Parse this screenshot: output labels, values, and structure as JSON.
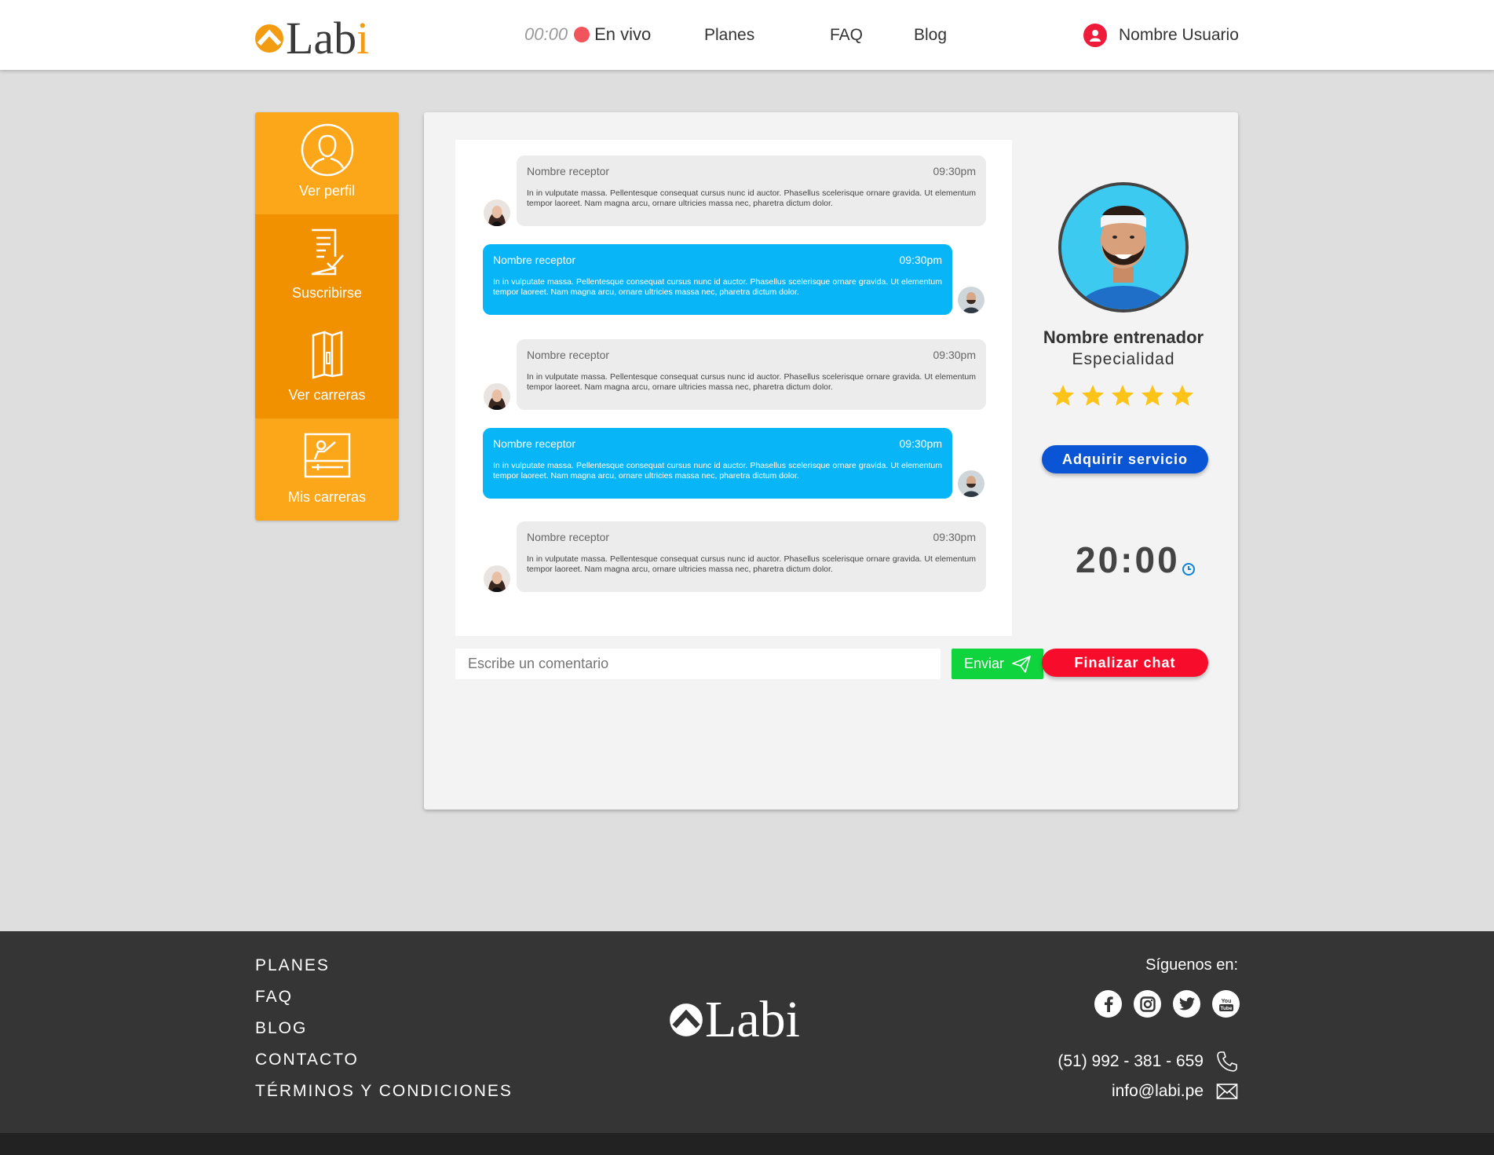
{
  "header": {
    "logo": {
      "text_main": "Lab",
      "text_accent": "i"
    },
    "live": {
      "time": "00:00",
      "label": "En vivo"
    },
    "nav": [
      "Planes",
      "FAQ",
      "Blog"
    ],
    "user_name": "Nombre Usuario"
  },
  "sidebar": {
    "items": [
      {
        "label": "Ver perfil",
        "icon": "user-circle-icon"
      },
      {
        "label": "Suscribirse",
        "icon": "document-check-icon"
      },
      {
        "label": "Ver carreras",
        "icon": "brochure-icon"
      },
      {
        "label": "Mis carreras",
        "icon": "presentation-board-icon"
      }
    ]
  },
  "chat": {
    "messages": [
      {
        "direction": "in",
        "sender": "Nombre receptor",
        "time": "09:30pm",
        "text": "In in vulputate massa. Pellentesque consequat cursus nunc id auctor. Phasellus scelerisque ornare gravida. Ut elementum tempor laoreet. Nam magna arcu, ornare ultricies massa nec, pharetra dictum dolor."
      },
      {
        "direction": "out",
        "sender": "Nombre receptor",
        "time": "09:30pm",
        "text": "In in vulputate massa. Pellentesque consequat cursus nunc id auctor. Phasellus scelerisque ornare gravida. Ut elementum tempor laoreet. Nam magna arcu, ornare ultricies massa nec, pharetra dictum dolor."
      },
      {
        "direction": "in",
        "sender": "Nombre receptor",
        "time": "09:30pm",
        "text": "In in vulputate massa. Pellentesque consequat cursus nunc id auctor. Phasellus scelerisque ornare gravida. Ut elementum tempor laoreet. Nam magna arcu, ornare ultricies massa nec, pharetra dictum dolor."
      },
      {
        "direction": "out",
        "sender": "Nombre receptor",
        "time": "09:30pm",
        "text": "In in vulputate massa. Pellentesque consequat cursus nunc id auctor. Phasellus scelerisque ornare gravida. Ut elementum tempor laoreet. Nam magna arcu, ornare ultricies massa nec, pharetra dictum dolor."
      },
      {
        "direction": "in",
        "sender": "Nombre receptor",
        "time": "09:30pm",
        "text": "In in vulputate massa. Pellentesque consequat cursus nunc id auctor. Phasellus scelerisque ornare gravida. Ut elementum tempor laoreet. Nam magna arcu, ornare ultricies massa nec, pharetra dictum dolor."
      }
    ],
    "input_placeholder": "Escribe un comentario",
    "send_label": "Enviar"
  },
  "trainer": {
    "name": "Nombre entrenador",
    "specialty": "Especialidad",
    "rating": 5,
    "rating_max": 5,
    "acquire_label": "Adquirir servicio",
    "timer": "20:00",
    "end_label": "Finalizar chat"
  },
  "footer": {
    "links": [
      "PLANES",
      "FAQ",
      "BLOG",
      "CONTACTO",
      "TÉRMINOS Y CONDICIONES"
    ],
    "logo_text": "Labi",
    "follow_label": "Síguenos en:",
    "socials": [
      "facebook-icon",
      "instagram-icon",
      "twitter-icon",
      "youtube-icon"
    ],
    "phone": "(51) 992 - 381 - 659",
    "email": "info@labi.pe"
  },
  "colors": {
    "brand_orange": "#fca619",
    "brand_orange_dark": "#f29100",
    "chat_out": "#08b5f7",
    "chat_in": "#ececec",
    "send_green": "#0fd43d",
    "btn_blue": "#0a55d6",
    "btn_red": "#f70d2b",
    "live_dot": "#f2545b",
    "star": "#fcc419"
  }
}
